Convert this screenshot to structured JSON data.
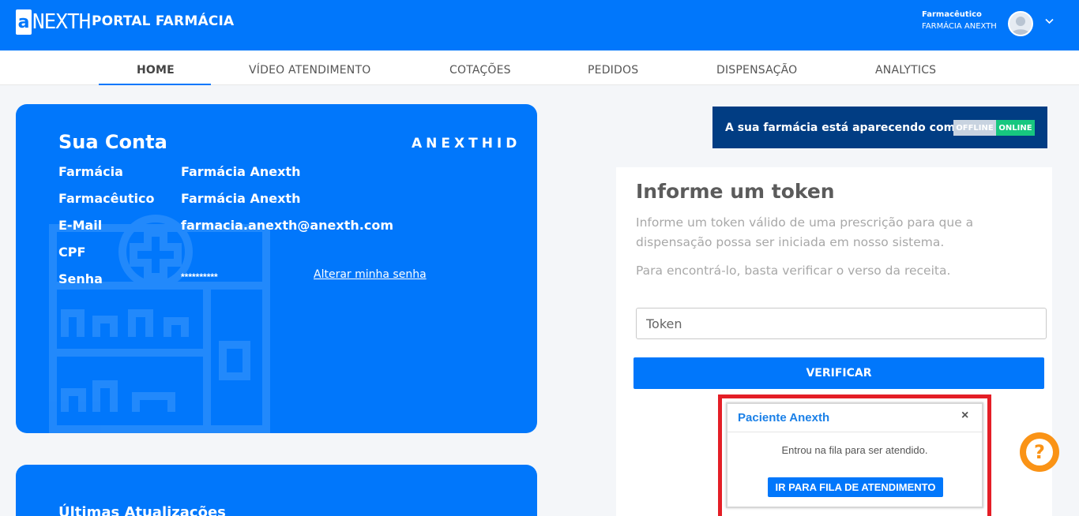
{
  "header": {
    "logo_mark": "a",
    "logo_text": "NEXTH",
    "portal_title": "PORTAL FARMÁCIA",
    "user_role": "Farmacêutico",
    "user_pharmacy": "FARMÁCIA ANEXTH",
    "avatar_icon": "user-avatar-icon",
    "menu_icon": "chevron-down-icon"
  },
  "nav": {
    "tabs": [
      {
        "label": "HOME",
        "active": true
      },
      {
        "label": "VÍDEO ATENDIMENTO"
      },
      {
        "label": "COTAÇÕES"
      },
      {
        "label": "PEDIDOS"
      },
      {
        "label": "DISPENSAÇÃO"
      },
      {
        "label": "ANALYTICS"
      }
    ]
  },
  "account": {
    "title": "Sua Conta",
    "brand": "ANEXTHID",
    "rows": [
      {
        "label": "Farmácia",
        "value": "Farmácia Anexth"
      },
      {
        "label": "Farmacêutico",
        "value": "Farmácia Anexth"
      },
      {
        "label": "E-Mail",
        "value": "farmacia.anexth@anexth.com"
      },
      {
        "label": "CPF",
        "value": ""
      },
      {
        "label": "Senha",
        "value": "**********"
      }
    ],
    "change_password": "Alterar minha senha"
  },
  "updates": {
    "title": "Últimas Atualizações"
  },
  "status": {
    "text": "A sua farmácia está aparecendo como",
    "offline_label": "OFFLINE",
    "online_label": "ONLINE",
    "state": "online"
  },
  "token": {
    "title": "Informe um token",
    "description": "Informe um token válido de uma prescrição para que a dispensação possa ser iniciada em nosso sistema.",
    "hint": "Para encontrá-lo, basta verificar o verso da receita.",
    "placeholder": "Token",
    "value": "",
    "verify_label": "VERIFICAR"
  },
  "notification": {
    "title": "Paciente Anexth",
    "close": "×",
    "message": "Entrou na fila para ser atendido.",
    "action_label": "IR PARA FILA DE ATENDIMENTO"
  },
  "help": {
    "icon": "question-icon",
    "symbol": "?"
  },
  "colors": {
    "primary": "#0177fb",
    "banner_dark": "#013d83",
    "online": "#17c77f",
    "offline": "#c8d3e0",
    "help": "#fa9316",
    "highlight": "#e41e26"
  }
}
